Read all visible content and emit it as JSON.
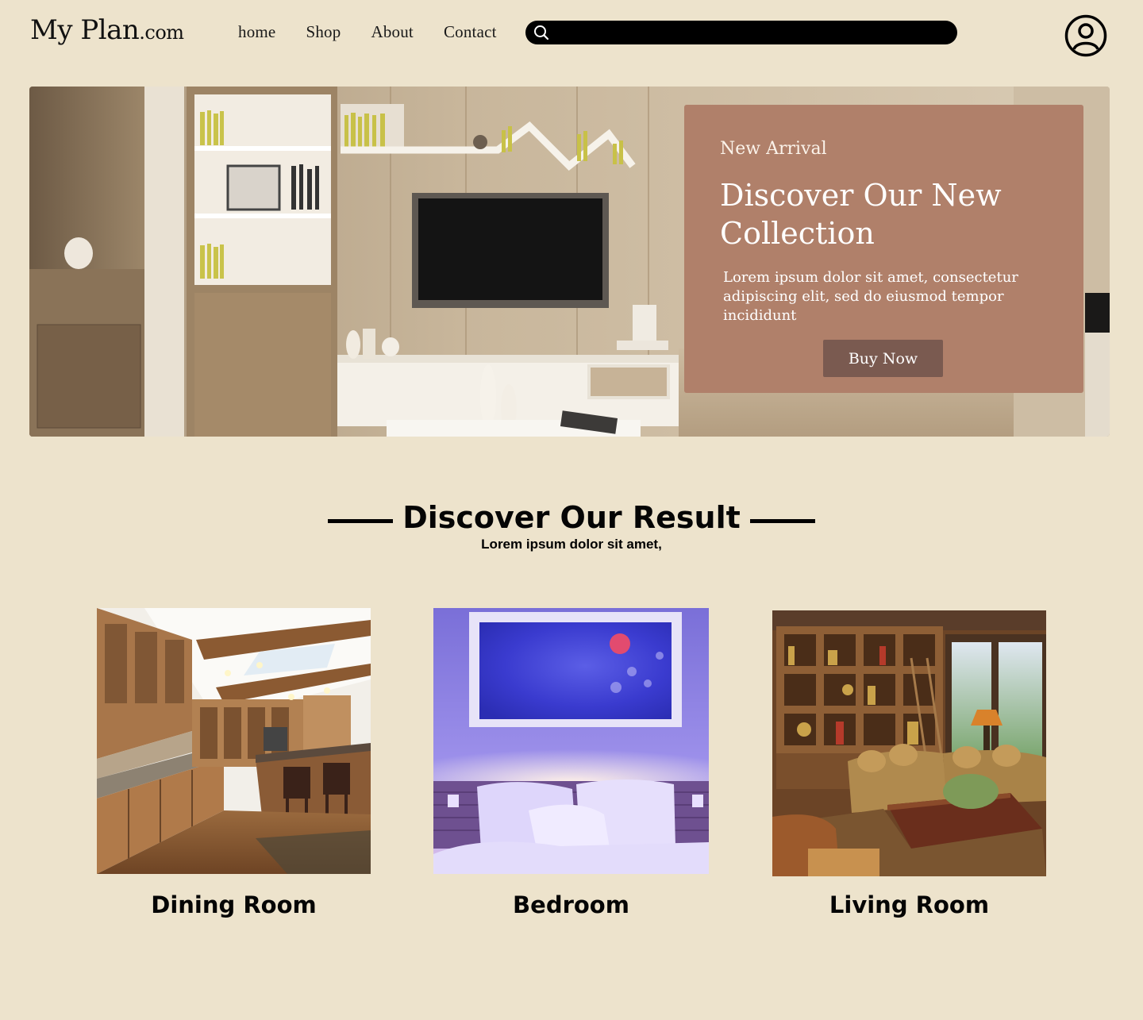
{
  "header": {
    "logo_main": "My Plan",
    "logo_suffix": ".com",
    "nav": [
      "home",
      "Shop",
      "About",
      "Contact"
    ],
    "search": {
      "value": "",
      "placeholder": ""
    }
  },
  "hero": {
    "kicker": "New Arrival",
    "headline": "Discover Our New Collection",
    "body": "Lorem ipsum dolor sit amet, consectetur adipiscing elit, sed do eiusmod tempor incididunt",
    "cta": "Buy Now"
  },
  "results": {
    "title": "Discover Our Result",
    "subtitle": "Lorem ipsum dolor sit amet,",
    "rooms": [
      {
        "label": "Dining Room"
      },
      {
        "label": "Bedroom"
      },
      {
        "label": "Living Room"
      }
    ]
  },
  "colors": {
    "page_background": "#ede3cc",
    "hero_card": "#b0806a",
    "cta_button": "#7a5a50",
    "search_bar": "#000000"
  }
}
